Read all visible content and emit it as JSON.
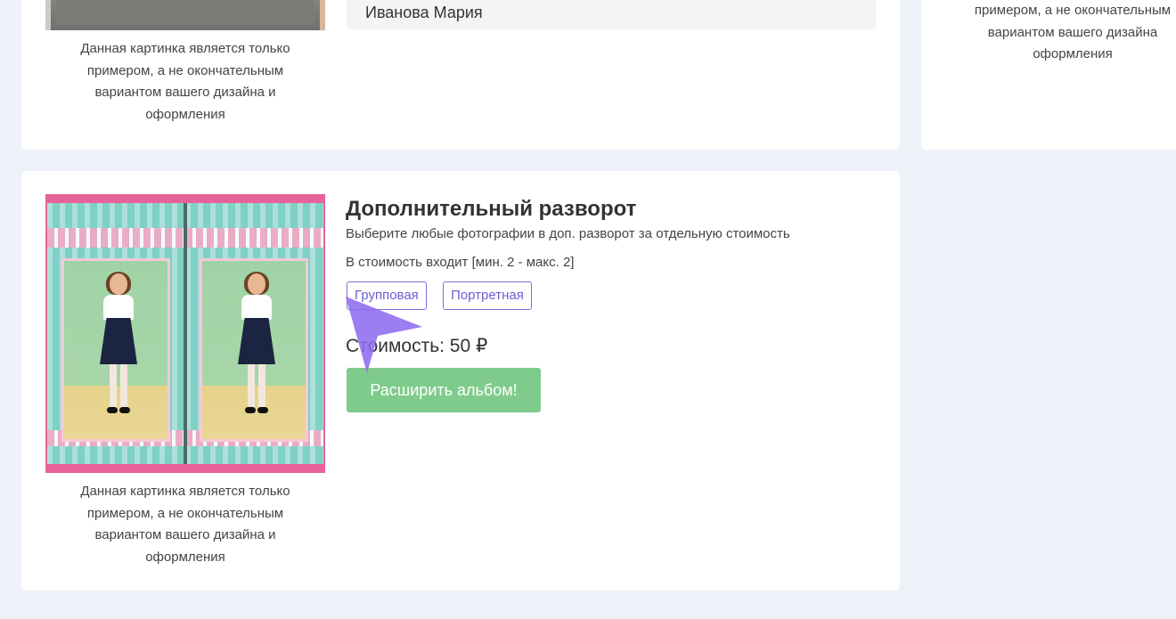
{
  "top_card": {
    "name": "Иванова Мария",
    "caption_lines": [
      "Данная картинка является только",
      "примером, а не окончательным",
      "вариантом вашего дизайна и",
      "оформления"
    ]
  },
  "right_card": {
    "caption_lines": [
      "примером, а не окончательным",
      "вариантом вашего дизайна",
      "оформления"
    ]
  },
  "product": {
    "title": "Дополнительный разворот",
    "description": "Выберите любые фотографии в доп. разворот за отдельную стоимость",
    "includes": "В стоимость входит [мин. 2 - макс. 2]",
    "tags": [
      "Групповая",
      "Портретная"
    ],
    "price": "Стоимость: 50 ₽",
    "button_label": "Расширить альбом!",
    "caption_lines": [
      "Данная картинка является только",
      "примером, а не окончательным",
      "вариантом вашего дизайна и",
      "оформления"
    ]
  },
  "colors": {
    "background": "#eef2f8",
    "tag_accent": "#6c5fd4",
    "button": "#7fcb8b",
    "cursor": "#8f6cf0"
  },
  "icons": {
    "cursor": "pointer-arrow-icon"
  }
}
